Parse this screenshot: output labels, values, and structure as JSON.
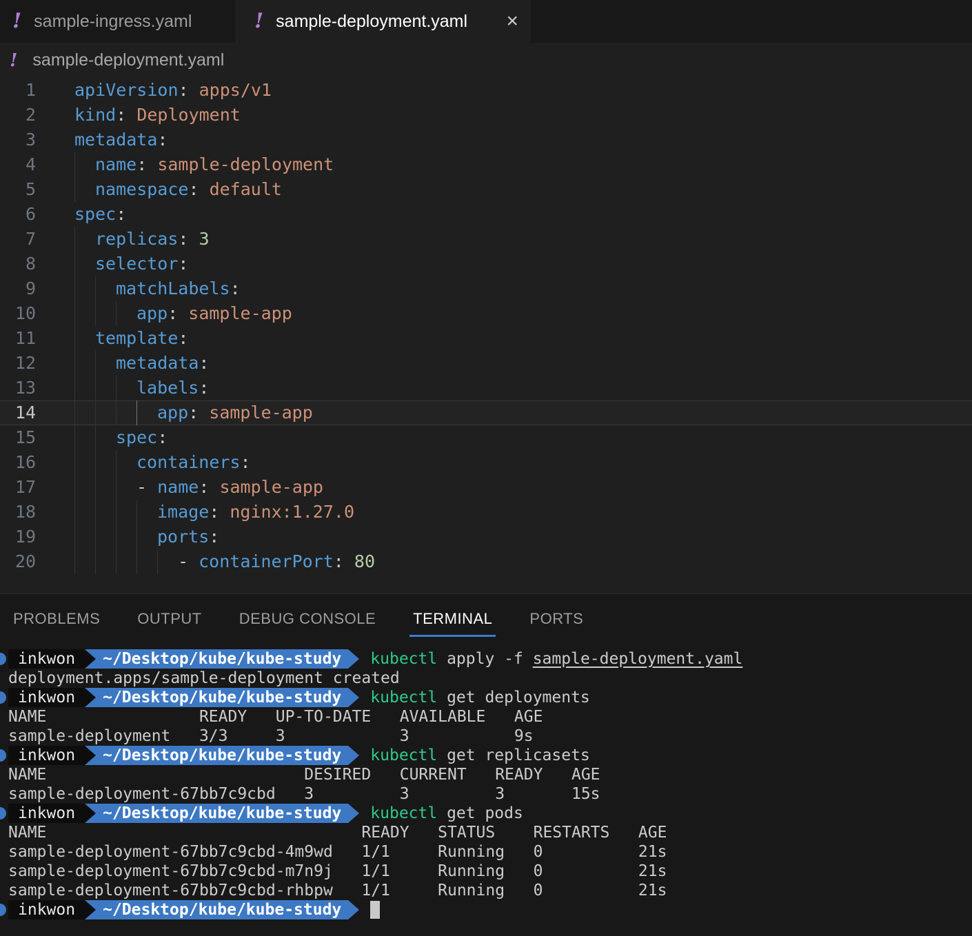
{
  "window": {
    "tabs": [
      {
        "icon": "!",
        "label": "sample-ingress.yaml",
        "active": false
      },
      {
        "icon": "!",
        "label": "sample-deployment.yaml",
        "active": true,
        "close_icon": "×"
      }
    ],
    "breadcrumb": {
      "icon": "!",
      "label": "sample-deployment.yaml"
    }
  },
  "colors": {
    "accent_blue_underline": "#3a7bd5",
    "prompt_blue": "#3d78c4",
    "prompt_black": "#0d0d0d",
    "kubectl_green": "#2fc98b",
    "yaml_icon_purple": "#b180d7",
    "yaml_key_blue": "#569cd6",
    "yaml_value_salmon": "#ce9178",
    "yaml_number_green": "#b5cea8"
  },
  "editor": {
    "lines": [
      {
        "num": "1",
        "guides": 0,
        "tokens": [
          [
            "key",
            "apiVersion"
          ],
          [
            "punc",
            ": "
          ],
          [
            "val",
            "apps/v1"
          ]
        ]
      },
      {
        "num": "2",
        "guides": 0,
        "tokens": [
          [
            "key",
            "kind"
          ],
          [
            "punc",
            ": "
          ],
          [
            "val",
            "Deployment"
          ]
        ]
      },
      {
        "num": "3",
        "guides": 0,
        "tokens": [
          [
            "key",
            "metadata"
          ],
          [
            "punc",
            ":"
          ]
        ]
      },
      {
        "num": "4",
        "guides": 1,
        "tokens": [
          [
            "key",
            "name"
          ],
          [
            "punc",
            ": "
          ],
          [
            "val",
            "sample-deployment"
          ]
        ]
      },
      {
        "num": "5",
        "guides": 1,
        "tokens": [
          [
            "key",
            "namespace"
          ],
          [
            "punc",
            ": "
          ],
          [
            "val",
            "default"
          ]
        ]
      },
      {
        "num": "6",
        "guides": 0,
        "tokens": [
          [
            "key",
            "spec"
          ],
          [
            "punc",
            ":"
          ]
        ]
      },
      {
        "num": "7",
        "guides": 1,
        "tokens": [
          [
            "key",
            "replicas"
          ],
          [
            "punc",
            ": "
          ],
          [
            "num",
            "3"
          ]
        ]
      },
      {
        "num": "8",
        "guides": 1,
        "tokens": [
          [
            "key",
            "selector"
          ],
          [
            "punc",
            ":"
          ]
        ]
      },
      {
        "num": "9",
        "guides": 2,
        "tokens": [
          [
            "key",
            "matchLabels"
          ],
          [
            "punc",
            ":"
          ]
        ]
      },
      {
        "num": "10",
        "guides": 3,
        "tokens": [
          [
            "key",
            "app"
          ],
          [
            "punc",
            ": "
          ],
          [
            "val",
            "sample-app"
          ]
        ]
      },
      {
        "num": "11",
        "guides": 1,
        "tokens": [
          [
            "key",
            "template"
          ],
          [
            "punc",
            ":"
          ]
        ]
      },
      {
        "num": "12",
        "guides": 2,
        "tokens": [
          [
            "key",
            "metadata"
          ],
          [
            "punc",
            ":"
          ]
        ]
      },
      {
        "num": "13",
        "guides": 3,
        "tokens": [
          [
            "key",
            "labels"
          ],
          [
            "punc",
            ":"
          ]
        ]
      },
      {
        "num": "14",
        "guides": 4,
        "current": true,
        "active_guide": 3,
        "tokens": [
          [
            "key",
            "app"
          ],
          [
            "punc",
            ": "
          ],
          [
            "val",
            "sample-app"
          ]
        ]
      },
      {
        "num": "15",
        "guides": 2,
        "tokens": [
          [
            "key",
            "spec"
          ],
          [
            "punc",
            ":"
          ]
        ]
      },
      {
        "num": "16",
        "guides": 3,
        "tokens": [
          [
            "key",
            "containers"
          ],
          [
            "punc",
            ":"
          ]
        ]
      },
      {
        "num": "17",
        "guides": 3,
        "tokens": [
          [
            "punc",
            "- "
          ],
          [
            "key",
            "name"
          ],
          [
            "punc",
            ": "
          ],
          [
            "val",
            "sample-app"
          ]
        ]
      },
      {
        "num": "18",
        "guides": 4,
        "tokens": [
          [
            "key",
            "image"
          ],
          [
            "punc",
            ": "
          ],
          [
            "val",
            "nginx:1.27.0"
          ]
        ]
      },
      {
        "num": "19",
        "guides": 4,
        "tokens": [
          [
            "key",
            "ports"
          ],
          [
            "punc",
            ":"
          ]
        ]
      },
      {
        "num": "20",
        "guides": 5,
        "tokens": [
          [
            "punc",
            "- "
          ],
          [
            "key",
            "containerPort"
          ],
          [
            "punc",
            ": "
          ],
          [
            "num",
            "80"
          ]
        ]
      }
    ]
  },
  "panel": {
    "tabs": [
      {
        "label": "PROBLEMS",
        "active": false
      },
      {
        "label": "OUTPUT",
        "active": false
      },
      {
        "label": "DEBUG CONSOLE",
        "active": false
      },
      {
        "label": "TERMINAL",
        "active": true
      },
      {
        "label": "PORTS",
        "active": false
      }
    ]
  },
  "terminal": {
    "prompt": {
      "user": "inkwon",
      "path": "~/Desktop/kube/kube-study"
    },
    "lines": [
      {
        "type": "prompt",
        "command": [
          [
            "cmd",
            "kubectl"
          ],
          [
            "plain",
            " apply -f "
          ],
          [
            "link",
            "sample-deployment.yaml"
          ]
        ]
      },
      {
        "type": "output",
        "text": "deployment.apps/sample-deployment created"
      },
      {
        "type": "prompt",
        "command": [
          [
            "cmd",
            "kubectl"
          ],
          [
            "plain",
            " get deployments"
          ]
        ]
      },
      {
        "type": "output",
        "text": "NAME                READY   UP-TO-DATE   AVAILABLE   AGE"
      },
      {
        "type": "output",
        "text": "sample-deployment   3/3     3            3           9s"
      },
      {
        "type": "prompt",
        "command": [
          [
            "cmd",
            "kubectl"
          ],
          [
            "plain",
            " get replicasets"
          ]
        ]
      },
      {
        "type": "output",
        "text": "NAME                           DESIRED   CURRENT   READY   AGE"
      },
      {
        "type": "output",
        "text": "sample-deployment-67bb7c9cbd   3         3         3       15s"
      },
      {
        "type": "prompt",
        "command": [
          [
            "cmd",
            "kubectl"
          ],
          [
            "plain",
            " get pods"
          ]
        ]
      },
      {
        "type": "output",
        "text": "NAME                                 READY   STATUS    RESTARTS   AGE"
      },
      {
        "type": "output",
        "text": "sample-deployment-67bb7c9cbd-4m9wd   1/1     Running   0          21s"
      },
      {
        "type": "output",
        "text": "sample-deployment-67bb7c9cbd-m7n9j   1/1     Running   0          21s"
      },
      {
        "type": "output",
        "text": "sample-deployment-67bb7c9cbd-rhbpw   1/1     Running   0          21s"
      },
      {
        "type": "prompt",
        "command": [],
        "cursor": true
      }
    ]
  }
}
